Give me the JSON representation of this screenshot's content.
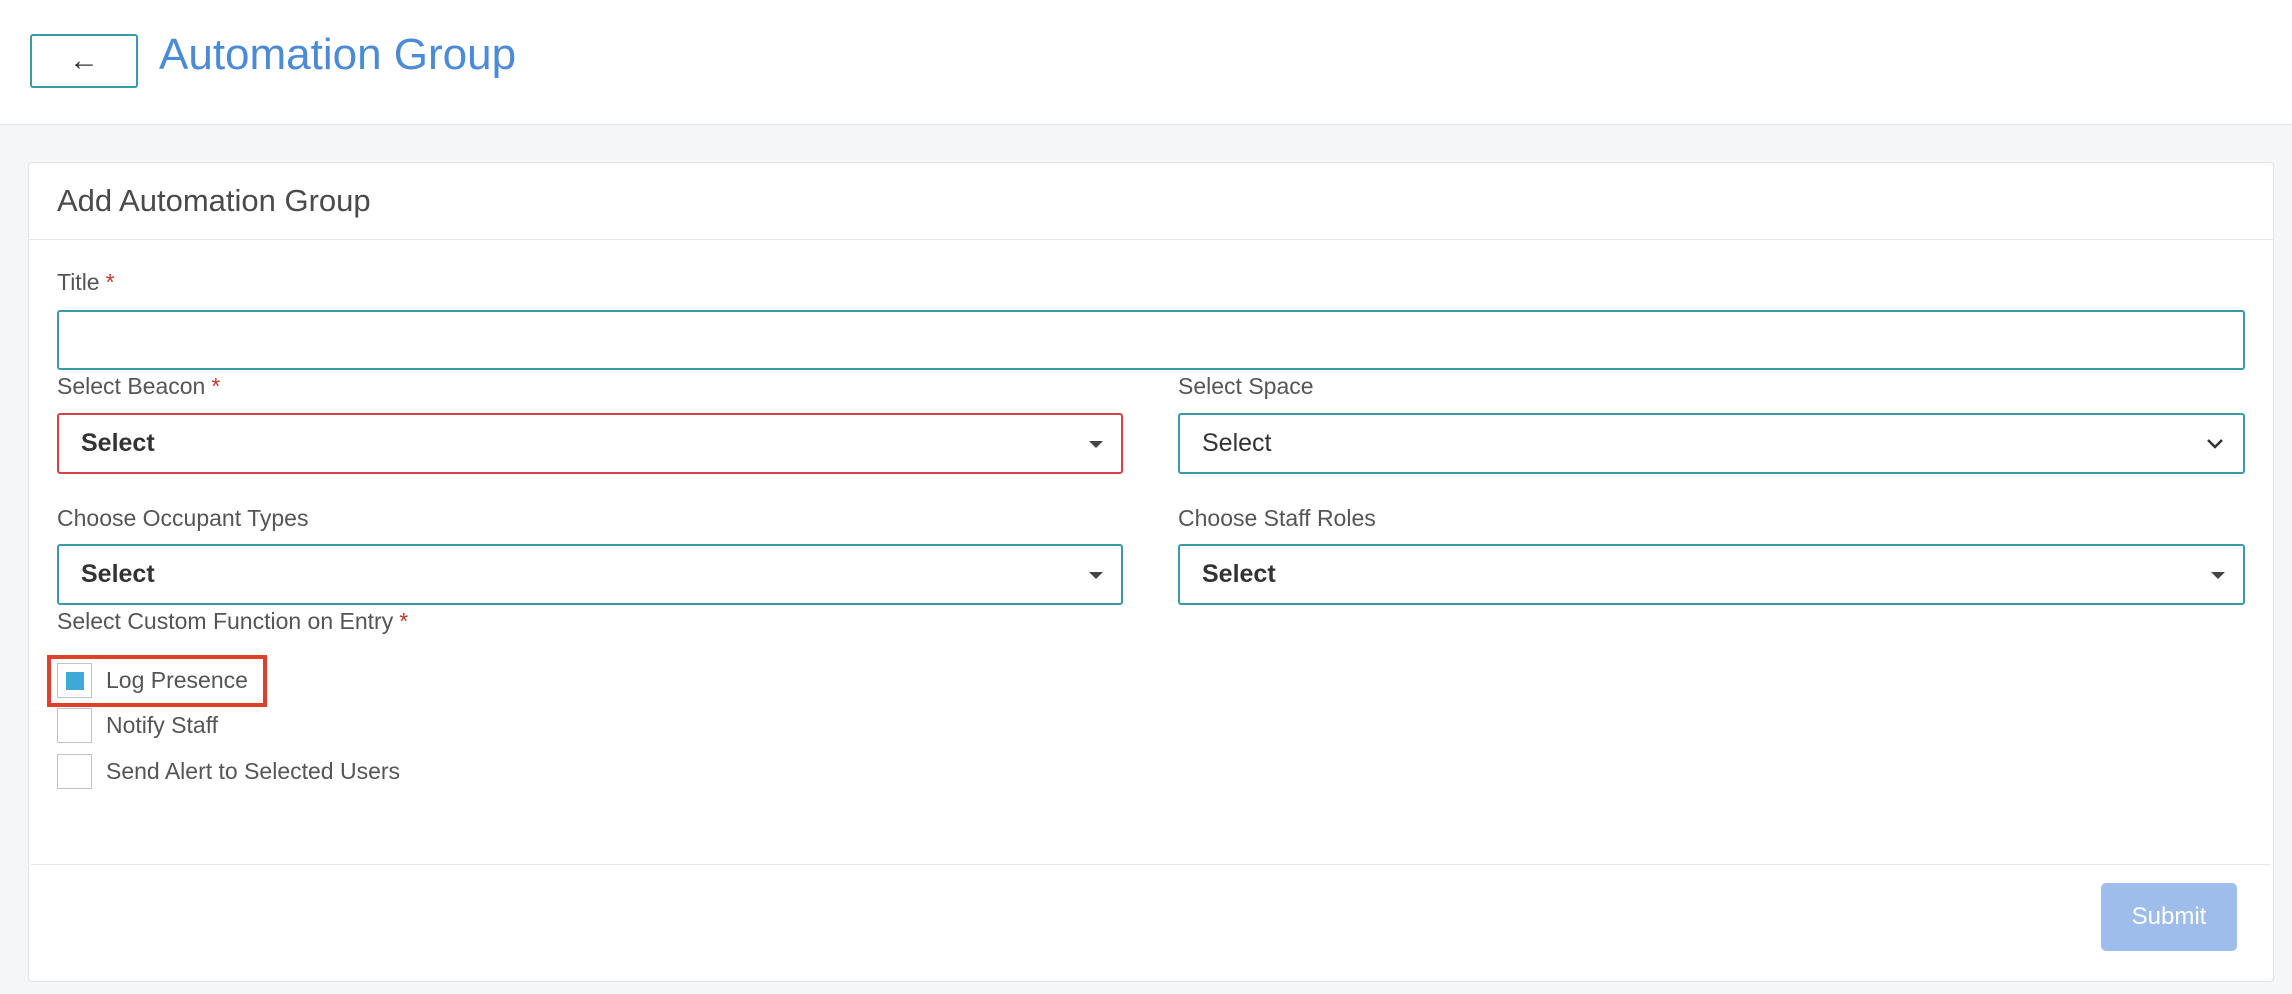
{
  "header": {
    "back_icon": "←",
    "title": "Automation Group"
  },
  "form": {
    "card_title": "Add Automation Group",
    "title_field": {
      "label": "Title",
      "required_mark": "*",
      "value": "",
      "placeholder": ""
    },
    "beacon": {
      "label": "Select Beacon",
      "required_mark": "*",
      "value": "Select"
    },
    "space": {
      "label": "Select Space",
      "value": "Select"
    },
    "occupant_types": {
      "label": "Choose Occupant Types",
      "value": "Select"
    },
    "staff_roles": {
      "label": "Choose Staff Roles",
      "value": "Select"
    },
    "custom_function": {
      "label": "Select Custom Function on Entry",
      "required_mark": "*",
      "options": [
        {
          "label": "Log Presence",
          "checked": true
        },
        {
          "label": "Notify Staff",
          "checked": false
        },
        {
          "label": "Send Alert to Selected Users",
          "checked": false
        }
      ]
    },
    "submit_label": "Submit"
  },
  "colors": {
    "accent": "#4a8ad6",
    "input_border": "#3a9aa8",
    "error_border": "#d0444a",
    "checkbox_fill": "#3fa8d8",
    "submit_bg": "#9fbdea",
    "highlight": "#e0402a"
  }
}
